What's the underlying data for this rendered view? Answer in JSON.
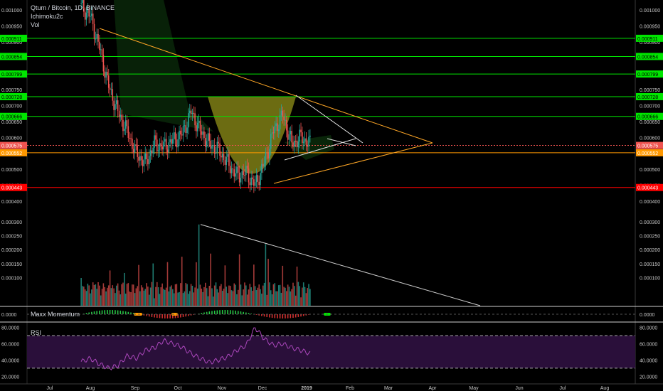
{
  "header": {
    "symbol_title": "Qtum / Bitcoin, 1D, BINANCE",
    "indicator1": "Ichimoku2c",
    "indicator2": "Vol"
  },
  "panes": {
    "momentum_label": "Maxx Momentum",
    "rsi_label": "RSI"
  },
  "colors": {
    "background": "#000000",
    "up_candle": "#26a69a",
    "down_candle": "#ef5350",
    "resistance_line": "#00e600",
    "support_line": "#ff9800",
    "low_line": "#ff0000",
    "trend_line": "#ffa726",
    "pattern_fill": "#9a9a1a",
    "rsi_line": "#ab47bc",
    "rsi_band": "#2a0f3a"
  },
  "chart_data": [
    {
      "type": "line",
      "title": "Qtum / Bitcoin, 1D, BINANCE",
      "x_ticks": [
        "Jul",
        "Aug",
        "Sep",
        "Oct",
        "Nov",
        "Dec",
        "2019",
        "Feb",
        "Mar",
        "Apr",
        "May",
        "Jun",
        "Jul",
        "Aug"
      ],
      "y_ticks": [
        "0.001000",
        "0.000950",
        "0.000900",
        "0.000850",
        "0.000800",
        "0.000750",
        "0.000700",
        "0.000650",
        "0.000600",
        "0.000550",
        "0.000500",
        "0.000450",
        "0.000400"
      ],
      "ylim": [
        0.00038,
        0.00102
      ],
      "x": [
        "Jul 25",
        "Aug 1",
        "Aug 8",
        "Aug 15",
        "Aug 22",
        "Aug 29",
        "Sep 5",
        "Sep 12",
        "Sep 19",
        "Sep 26",
        "Oct 3",
        "Oct 10",
        "Oct 17",
        "Oct 24",
        "Oct 31",
        "Nov 7",
        "Nov 14",
        "Nov 21",
        "Nov 28",
        "Dec 5",
        "Dec 12",
        "Dec 19",
        "Dec 26",
        "Jan 2",
        "Jan 9",
        "Jan 16"
      ],
      "series": [
        {
          "values": [
            0.00101,
            0.00098,
            0.00088,
            0.00076,
            0.00068,
            0.00062,
            0.00055,
            0.00052,
            0.00058,
            0.00057,
            0.00059,
            0.00061,
            0.00068,
            0.00062,
            0.00058,
            0.00056,
            0.00052,
            0.00048,
            0.00049,
            0.00045,
            0.00052,
            0.00062,
            0.00067,
            0.00058,
            0.0006,
            0.00058
          ]
        }
      ],
      "levels": [
        {
          "label": "0.000911",
          "value": 0.000911,
          "kind": "resistance"
        },
        {
          "label": "0.000854",
          "value": 0.000854,
          "kind": "resistance"
        },
        {
          "label": "0.000799",
          "value": 0.000799,
          "kind": "resistance"
        },
        {
          "label": "0.000728",
          "value": 0.000728,
          "kind": "resistance"
        },
        {
          "label": "0.000666",
          "value": 0.000666,
          "kind": "resistance"
        },
        {
          "label": "0.000575",
          "value": 0.000575,
          "kind": "price"
        },
        {
          "label": "0.000552",
          "value": 0.000552,
          "kind": "support"
        },
        {
          "label": "0.000443",
          "value": 0.000443,
          "kind": "low"
        }
      ]
    },
    {
      "type": "bar",
      "title": "Vol",
      "y_ticks": [
        "0.000300",
        "0.000250",
        "0.000200",
        "0.000150",
        "0.000100"
      ],
      "ylim": [
        0,
        0.00033
      ],
      "peaks": [
        0.00029,
        0.00022
      ]
    },
    {
      "type": "bar",
      "title": "Maxx Momentum",
      "y_ticks": [
        "0.0000"
      ]
    },
    {
      "type": "line",
      "title": "RSI",
      "y_ticks": [
        "80.0000",
        "60.0000",
        "40.0000",
        "20.0000"
      ],
      "ylim": [
        15,
        85
      ],
      "bands": [
        70,
        30
      ],
      "values": [
        38,
        42,
        35,
        30,
        33,
        45,
        42,
        52,
        55,
        64,
        60,
        56,
        48,
        42,
        37,
        40,
        44,
        52,
        58,
        80,
        66,
        58,
        60,
        55,
        52,
        48
      ]
    }
  ]
}
